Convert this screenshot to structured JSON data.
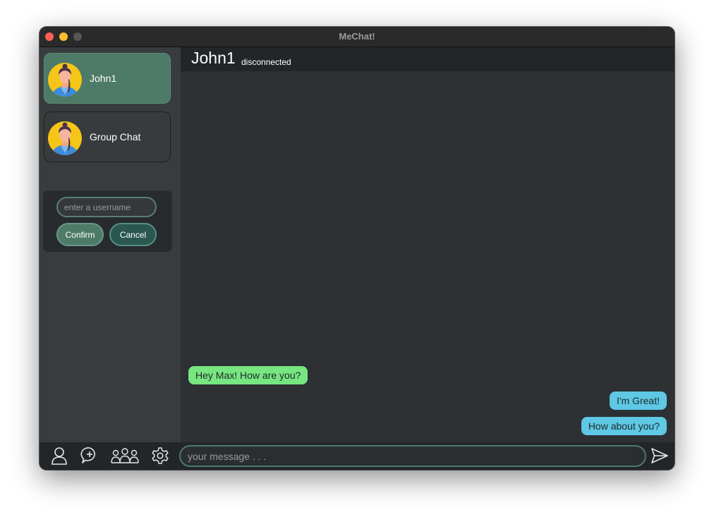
{
  "window": {
    "title": "MeChat!"
  },
  "sidebar": {
    "contacts": [
      {
        "name": "John1",
        "active": true,
        "avatar_icon": "user-avatar"
      },
      {
        "name": "Group Chat",
        "active": false,
        "avatar_icon": "user-avatar"
      }
    ],
    "add_user": {
      "placeholder": "enter a username",
      "value": "",
      "confirm_label": "Confirm",
      "cancel_label": "Cancel"
    }
  },
  "chat": {
    "name": "John1",
    "status": "disconnected",
    "messages": [
      {
        "direction": "incoming",
        "text": "Hey Max! How are you?"
      },
      {
        "direction": "outgoing",
        "text": "I'm Great!"
      },
      {
        "direction": "outgoing",
        "text": "How about you?"
      }
    ]
  },
  "bottom_bar": {
    "icons": [
      "user-icon",
      "new-chat-icon",
      "group-icon",
      "settings-icon",
      "send-icon"
    ],
    "message_placeholder": "your message . . .",
    "message_value": ""
  },
  "colors": {
    "accent": "#4e7a68",
    "incoming_bubble": "#77e680",
    "outgoing_bubble": "#5ec8e5",
    "background": "#2d3133"
  }
}
